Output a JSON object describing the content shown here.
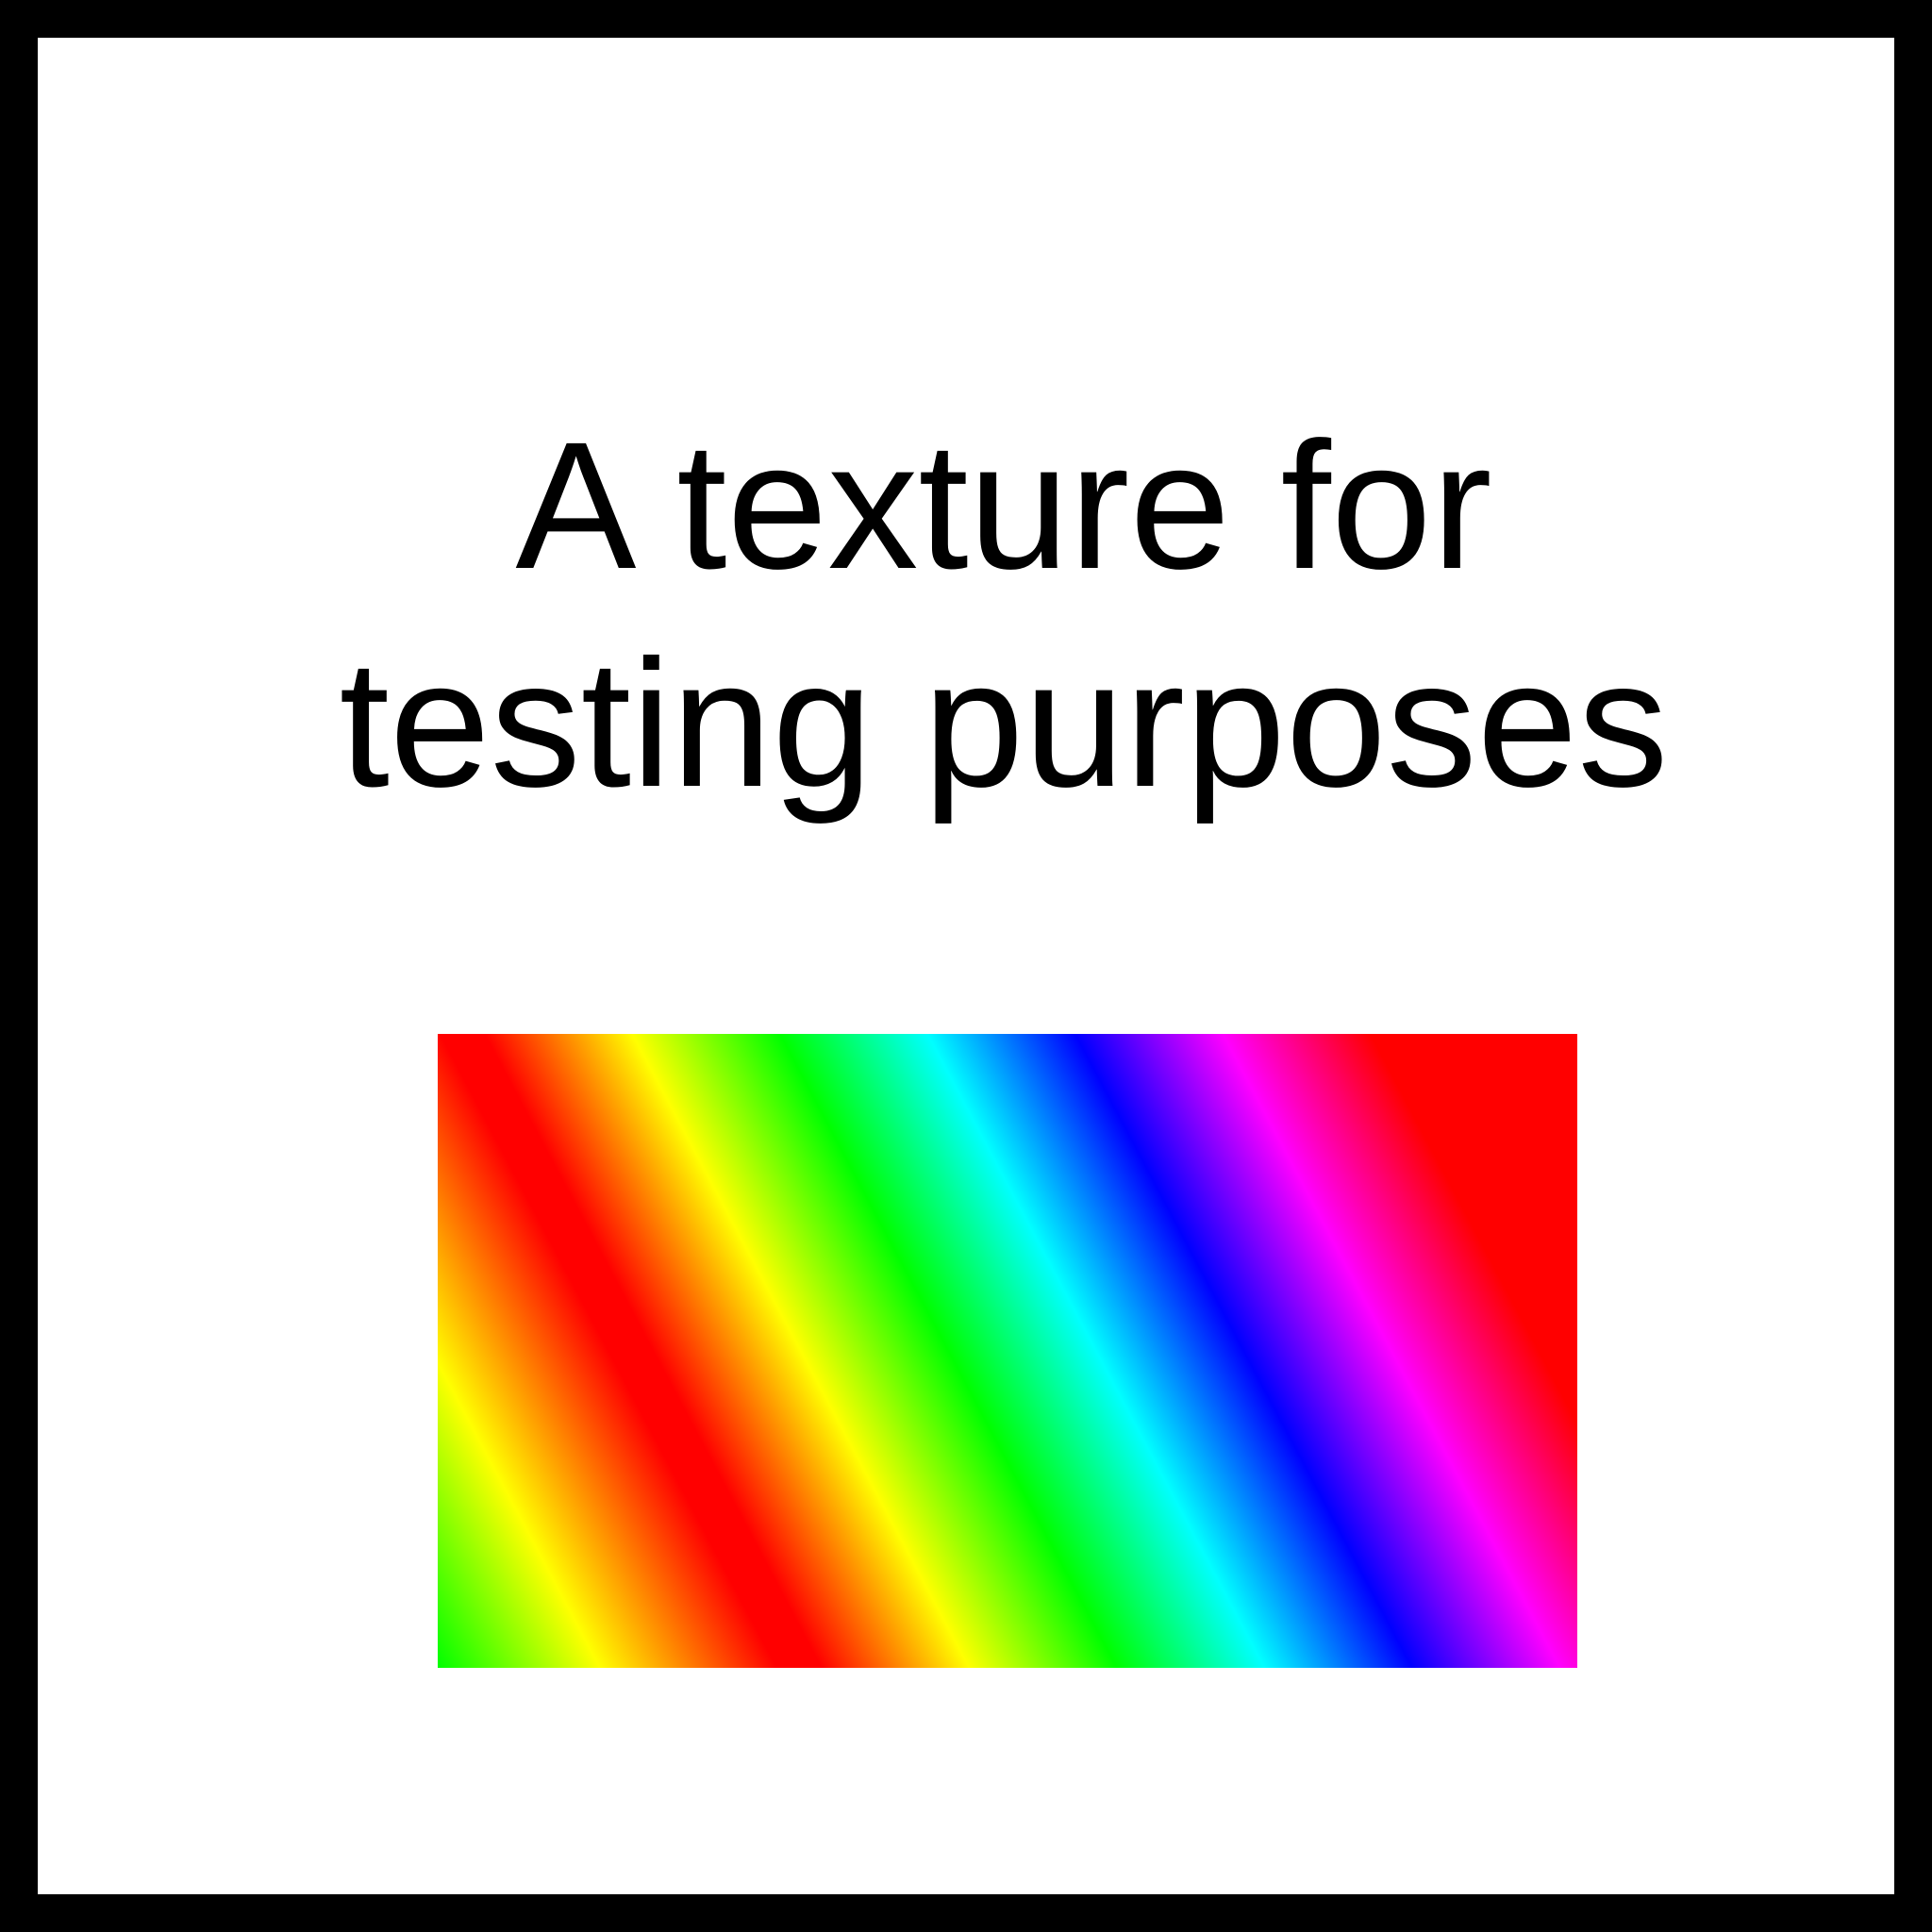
{
  "title": {
    "line1": "A texture for",
    "line2": "testing purposes"
  },
  "texture": {
    "description_colors": [
      "#ff0000",
      "#ffff00",
      "#00ff00",
      "#00ffff",
      "#0000ff",
      "#ff00ff",
      "#ff0000"
    ]
  },
  "colors": {
    "border": "#000000",
    "background": "#ffffff",
    "text": "#000000"
  }
}
